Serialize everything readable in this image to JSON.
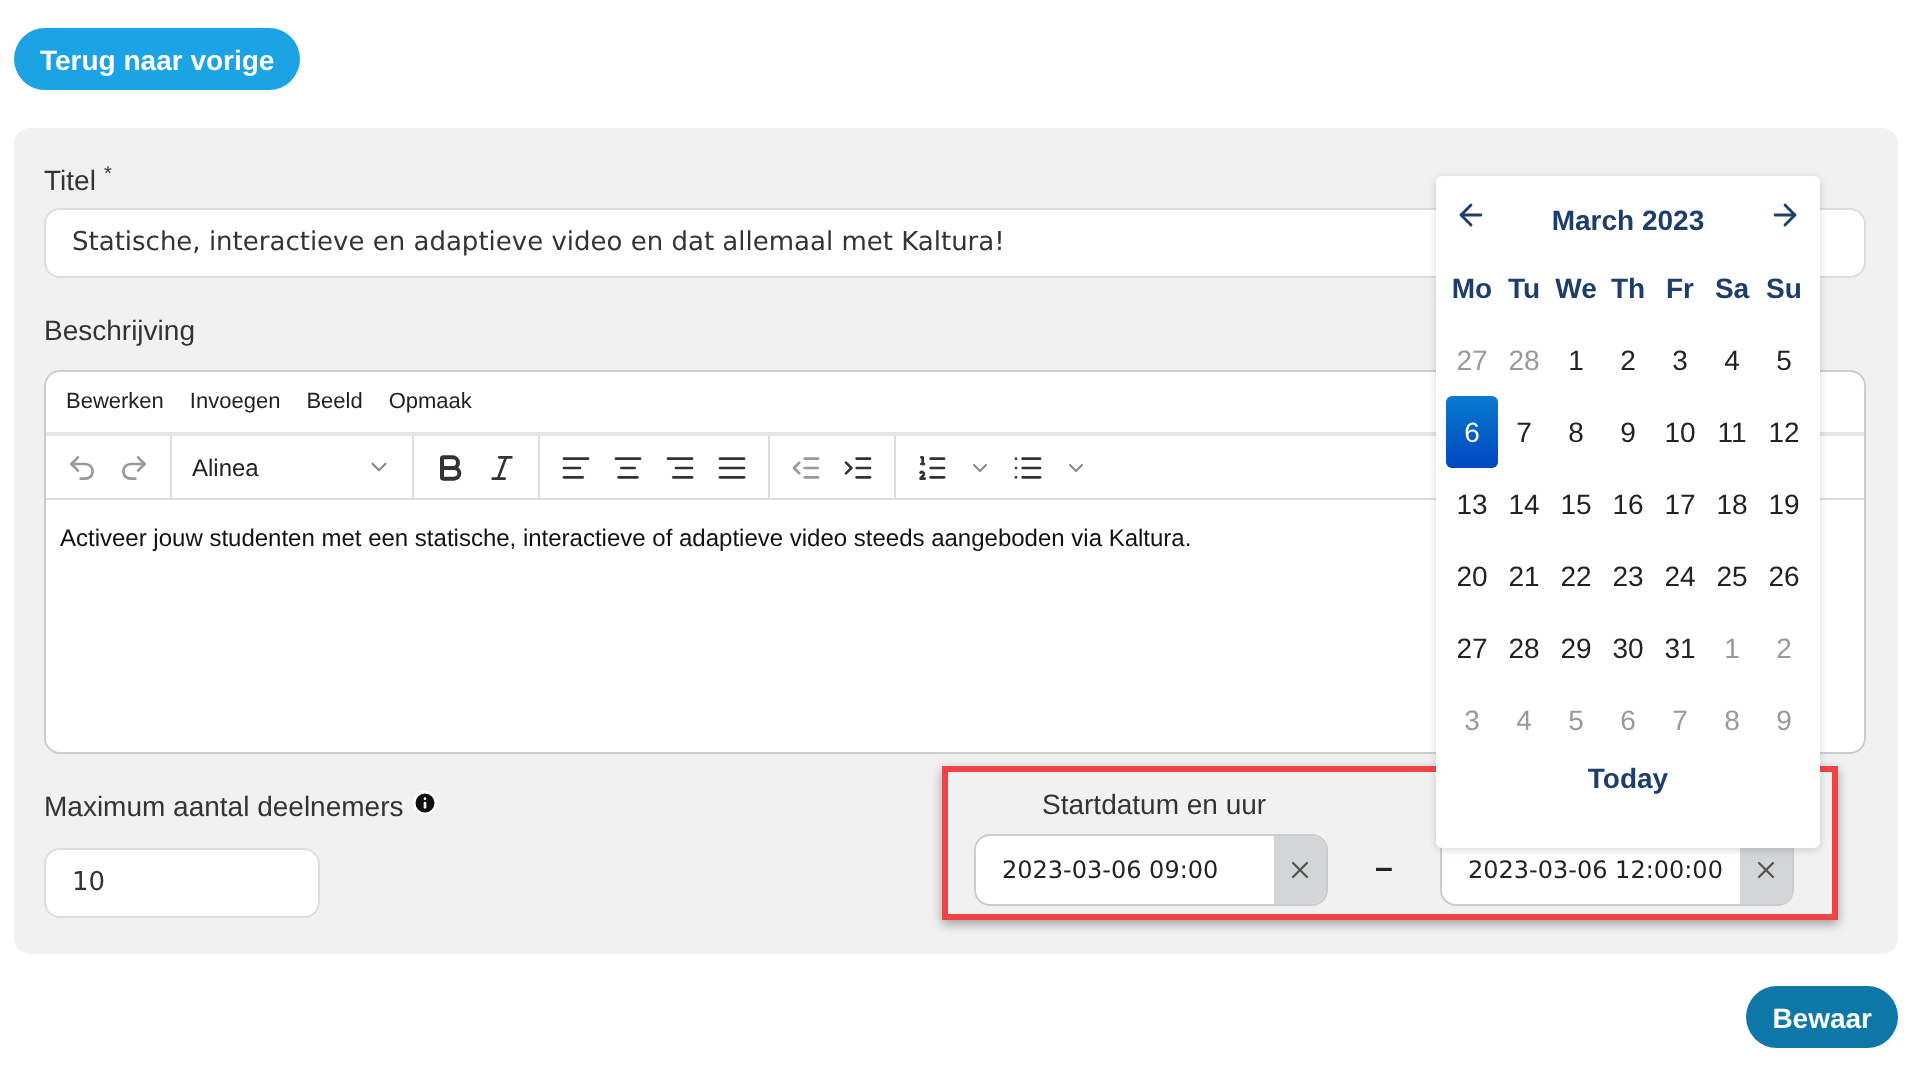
{
  "back_button": "Terug naar vorige",
  "title_field": {
    "label": "Titel",
    "required_mark": "*",
    "value": "Statische, interactieve en adaptieve video en dat allemaal met Kaltura!"
  },
  "description": {
    "label": "Beschrijving",
    "menu": [
      "Bewerken",
      "Invoegen",
      "Beeld",
      "Opmaak"
    ],
    "block_format": "Alinea",
    "content": "Activeer jouw studenten met een statische, interactieve of adaptieve video steeds aangeboden via Kaltura."
  },
  "max_participants": {
    "label": "Maximum aantal deelnemers",
    "value": "10"
  },
  "date_range": {
    "label": "Startdatum en uur",
    "start": "2023-03-06 09:00",
    "separator": "–",
    "end": "2023-03-06 12:00:00"
  },
  "calendar": {
    "month": "March 2023",
    "weekdays": [
      "Mo",
      "Tu",
      "We",
      "Th",
      "Fr",
      "Sa",
      "Su"
    ],
    "weeks": [
      [
        {
          "day": "27",
          "outside": true,
          "selected": false
        },
        {
          "day": "28",
          "outside": true,
          "selected": false
        },
        {
          "day": "1",
          "outside": false,
          "selected": false
        },
        {
          "day": "2",
          "outside": false,
          "selected": false
        },
        {
          "day": "3",
          "outside": false,
          "selected": false
        },
        {
          "day": "4",
          "outside": false,
          "selected": false
        },
        {
          "day": "5",
          "outside": false,
          "selected": false
        }
      ],
      [
        {
          "day": "6",
          "outside": false,
          "selected": true
        },
        {
          "day": "7",
          "outside": false,
          "selected": false
        },
        {
          "day": "8",
          "outside": false,
          "selected": false
        },
        {
          "day": "9",
          "outside": false,
          "selected": false
        },
        {
          "day": "10",
          "outside": false,
          "selected": false
        },
        {
          "day": "11",
          "outside": false,
          "selected": false
        },
        {
          "day": "12",
          "outside": false,
          "selected": false
        }
      ],
      [
        {
          "day": "13",
          "outside": false,
          "selected": false
        },
        {
          "day": "14",
          "outside": false,
          "selected": false
        },
        {
          "day": "15",
          "outside": false,
          "selected": false
        },
        {
          "day": "16",
          "outside": false,
          "selected": false
        },
        {
          "day": "17",
          "outside": false,
          "selected": false
        },
        {
          "day": "18",
          "outside": false,
          "selected": false
        },
        {
          "day": "19",
          "outside": false,
          "selected": false
        }
      ],
      [
        {
          "day": "20",
          "outside": false,
          "selected": false
        },
        {
          "day": "21",
          "outside": false,
          "selected": false
        },
        {
          "day": "22",
          "outside": false,
          "selected": false
        },
        {
          "day": "23",
          "outside": false,
          "selected": false
        },
        {
          "day": "24",
          "outside": false,
          "selected": false
        },
        {
          "day": "25",
          "outside": false,
          "selected": false
        },
        {
          "day": "26",
          "outside": false,
          "selected": false
        }
      ],
      [
        {
          "day": "27",
          "outside": false,
          "selected": false
        },
        {
          "day": "28",
          "outside": false,
          "selected": false
        },
        {
          "day": "29",
          "outside": false,
          "selected": false
        },
        {
          "day": "30",
          "outside": false,
          "selected": false
        },
        {
          "day": "31",
          "outside": false,
          "selected": false
        },
        {
          "day": "1",
          "outside": true,
          "selected": false
        },
        {
          "day": "2",
          "outside": true,
          "selected": false
        }
      ],
      [
        {
          "day": "3",
          "outside": true,
          "selected": false
        },
        {
          "day": "4",
          "outside": true,
          "selected": false
        },
        {
          "day": "5",
          "outside": true,
          "selected": false
        },
        {
          "day": "6",
          "outside": true,
          "selected": false
        },
        {
          "day": "7",
          "outside": true,
          "selected": false
        },
        {
          "day": "8",
          "outside": true,
          "selected": false
        },
        {
          "day": "9",
          "outside": true,
          "selected": false
        }
      ]
    ],
    "today_button": "Today"
  },
  "save_button": "Bewaar"
}
